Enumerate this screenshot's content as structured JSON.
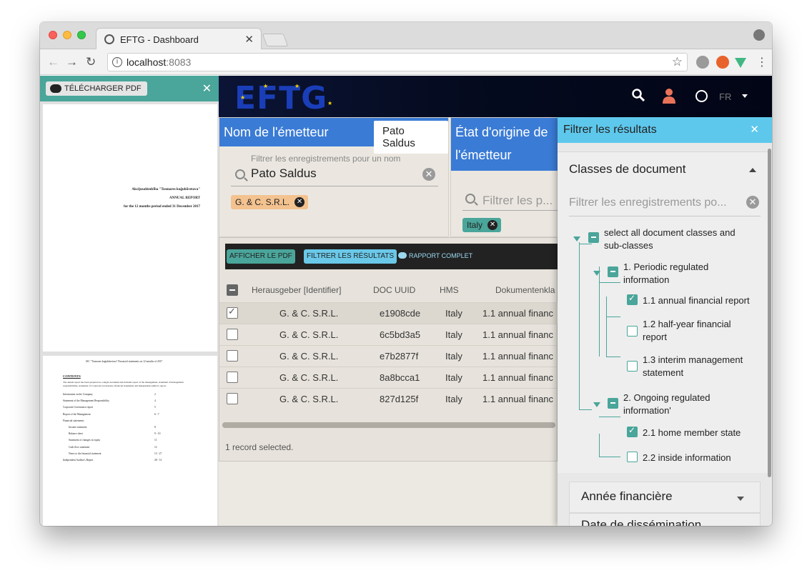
{
  "browser": {
    "tab_title": "EFTG - Dashboard",
    "url_host": "localhost",
    "url_port": ":8083"
  },
  "pdf": {
    "download_label": "TÉLÉCHARGER PDF",
    "page1": {
      "line1": "Akcijusabiedrība \"Tosmares kuģubūvetava\"",
      "line2": "ANNUAL REPORT",
      "line3": "for the 12 months period ended 31 December 2017"
    },
    "page2": {
      "header": "JSC \"Tosmares kuģubūvetava\" Financial statements on 12 months of 2017",
      "contents": "CONTENTS",
      "intro1": "The annual report has been prepared as a single document and includes report of the management, statement of management",
      "intro2": "responsibilities, statement of Corporate Governance, financial statements and Independent auditor's report.",
      "toc": [
        {
          "label": "Information on the Company",
          "page": "2"
        },
        {
          "label": "Statement of the Management Responsibility",
          "page": "4"
        },
        {
          "label": "Corporate Governance report",
          "page": "5"
        },
        {
          "label": "Report of the Management",
          "page": "6 - 7"
        },
        {
          "label": "Financial statements",
          "page": ""
        },
        {
          "label": "Income statement",
          "page": "8"
        },
        {
          "label": "Balance sheet",
          "page": "9 - 10"
        },
        {
          "label": "Statement of changes in equity",
          "page": "11"
        },
        {
          "label": "Cash flow statement",
          "page": "12"
        },
        {
          "label": "Notes to the financial statement",
          "page": "13 - 27"
        },
        {
          "label": "Independent Auditor's Report",
          "page": "28 - 31"
        }
      ]
    }
  },
  "header": {
    "logo": "EFTG",
    "lang": "FR"
  },
  "facet_issuer": {
    "title": "Nom de l'émetteur",
    "selected_pill": "Pato Saldus",
    "search_hint": "Filtrer les enregistrements pour un nom",
    "search_value": "Pato Saldus",
    "chip": "G. & C. S.R.L."
  },
  "facet_state": {
    "title_line1": "État d'origine de",
    "title_line2": "l'émetteur",
    "search_placeholder": "Filtrer les p...",
    "chip": "Italy"
  },
  "results": {
    "btn_show_pdf": "AFFICHER LE PDF",
    "btn_filter": "FILTRER LES RÉSULTATS",
    "btn_report": "RAPPORT COMPLET",
    "columns": [
      "Herausgeber [Identifier]",
      "DOC UUID",
      "HMS",
      "Dokumentenkla"
    ],
    "rows": [
      {
        "issuer": "G. & C. S.R.L.",
        "uuid": "e1908cde",
        "hms": "Italy",
        "doc": "1.1 annual financ",
        "selected": true
      },
      {
        "issuer": "G. & C. S.R.L.",
        "uuid": "6c5bd3a5",
        "hms": "Italy",
        "doc": "1.1 annual financ",
        "selected": false
      },
      {
        "issuer": "G. & C. S.R.L.",
        "uuid": "e7b2877f",
        "hms": "Italy",
        "doc": "1.1 annual financ",
        "selected": false
      },
      {
        "issuer": "G. & C. S.R.L.",
        "uuid": "8a8bcca1",
        "hms": "Italy",
        "doc": "1.1 annual financ",
        "selected": false
      },
      {
        "issuer": "G. & C. S.R.L.",
        "uuid": "827d125f",
        "hms": "Italy",
        "doc": "1.1 annual financ",
        "selected": false
      }
    ],
    "records_text": "1 record selected."
  },
  "filter_panel": {
    "title": "Filtrer les résultats",
    "section_title": "Classes de document",
    "search_placeholder": "Filtrer les enregistrements po...",
    "tree": {
      "root_l1": "select all document classes and",
      "root_l2": "sub-classes",
      "g1_l1": "1. Periodic regulated",
      "g1_l2": "information",
      "g1_i1": "1.1 annual financial report",
      "g1_i2_l1": "1.2 half-year financial",
      "g1_i2_l2": "report",
      "g1_i3_l1": "1.3 interim management",
      "g1_i3_l2": "statement",
      "g2_l1": "2. Ongoing regulated",
      "g2_l2": "information'",
      "g2_i1": "2.1 home member state",
      "g2_i2": "2.2 inside information"
    },
    "section2_title": "Année financière",
    "section3_title": "Date de dissémination"
  },
  "colors": {
    "teal": "#4aa59a",
    "blue_header": "#3a7bd5",
    "light_blue": "#5ec8ec",
    "navy": "#050b20"
  }
}
